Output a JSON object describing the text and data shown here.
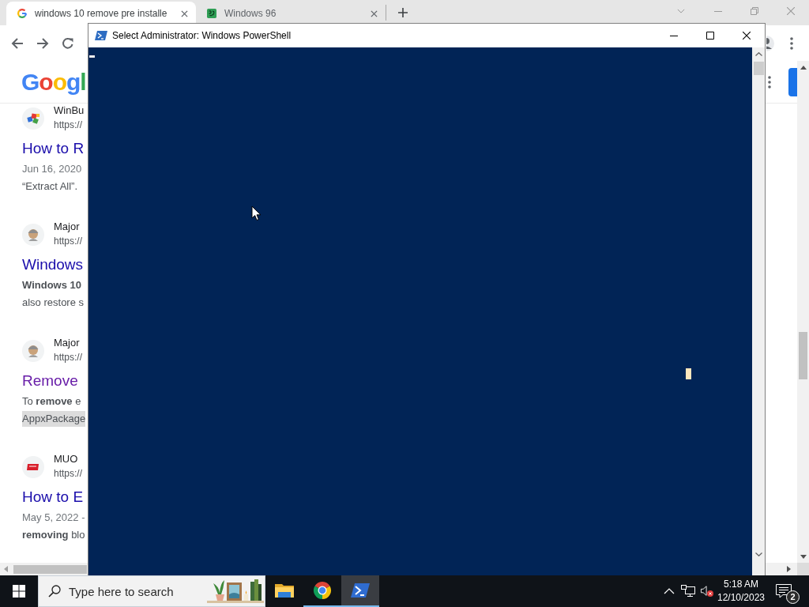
{
  "browser": {
    "tabs": [
      {
        "title": "windows 10 remove pre installe",
        "kind": "google",
        "selected": true
      },
      {
        "title": "Windows 96",
        "kind": "tile",
        "selected": false
      }
    ],
    "logo": "Googl",
    "results": [
      {
        "site": "WinBu",
        "url": "https://",
        "kind": "cubes",
        "title": "How to R",
        "visited": false,
        "snippet": [
          {
            "text": "Jun 16, 2020",
            "kind": "date"
          },
          {
            "text": "“Extract All”.",
            "kind": "text"
          }
        ]
      },
      {
        "site": "Major",
        "url": "https://",
        "kind": "mascot",
        "title": "Windows",
        "visited": false,
        "snippet": [
          {
            "text": "Windows 10",
            "kind": "bold"
          },
          {
            "text": "also restore s",
            "kind": "text"
          }
        ]
      },
      {
        "site": "Major",
        "url": "https://",
        "kind": "mascot",
        "title": "Remove",
        "visited": true,
        "snippet": [
          {
            "text": "To **remove** e",
            "kind": "text"
          },
          {
            "text": "AppxPackage",
            "kind": "code"
          }
        ]
      },
      {
        "site": "MUO",
        "url": "https://",
        "kind": "tag",
        "title": "How to E",
        "visited": false,
        "snippet": [
          {
            "text": "May 5, 2022 -",
            "kind": "date"
          },
          {
            "text": "**removing** blo",
            "kind": "text"
          }
        ]
      }
    ]
  },
  "powershell": {
    "title": "Select Administrator: Windows PowerShell"
  },
  "taskbar": {
    "search": {
      "placeholder": "Type here to search"
    },
    "apps": [
      {
        "kind": "folder",
        "running": false,
        "selected": false
      },
      {
        "kind": "chrome",
        "running": true,
        "selected": false
      },
      {
        "kind": "shell",
        "running": true,
        "selected": true
      }
    ],
    "volume": {
      "muted": true
    },
    "clock": {
      "time": "5:18 AM",
      "date": "12/10/2023"
    },
    "notifications": {
      "count": "2"
    }
  }
}
